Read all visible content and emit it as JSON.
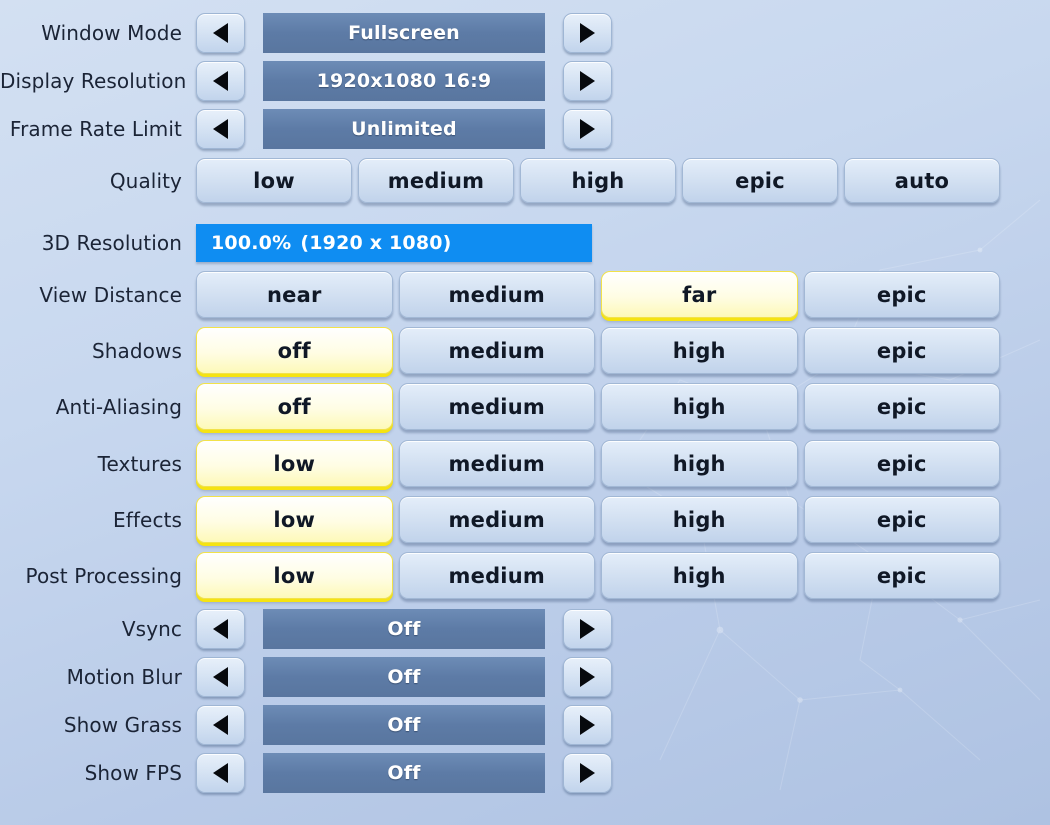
{
  "theme": {
    "accent_blue": "#0f8df2",
    "value_bar_blue": "#5d7ba6",
    "selected_yellow": "#f5e312",
    "label_color": "#1b2436"
  },
  "icons": {
    "left_arrow": "left-arrow-icon",
    "right_arrow": "right-arrow-icon"
  },
  "settings": {
    "window_mode": {
      "label": "Window Mode",
      "type": "stepper",
      "value": "Fullscreen"
    },
    "display_resolution": {
      "label": "Display Resolution",
      "type": "stepper",
      "value": "1920x1080 16:9"
    },
    "frame_rate_limit": {
      "label": "Frame Rate Limit",
      "type": "stepper",
      "value": "Unlimited"
    },
    "quality": {
      "label": "Quality",
      "type": "segmented",
      "options": [
        "low",
        "medium",
        "high",
        "epic",
        "auto"
      ],
      "selected_index": -1
    },
    "resolution_3d": {
      "label": "3D Resolution",
      "type": "slider",
      "percent": "100.0%",
      "detail": "(1920 x 1080)",
      "fill_percent": 100
    },
    "view_distance": {
      "label": "View Distance",
      "type": "segmented",
      "options": [
        "near",
        "medium",
        "far",
        "epic"
      ],
      "selected_index": 2
    },
    "shadows": {
      "label": "Shadows",
      "type": "segmented",
      "options": [
        "off",
        "medium",
        "high",
        "epic"
      ],
      "selected_index": 0
    },
    "anti_aliasing": {
      "label": "Anti-Aliasing",
      "type": "segmented",
      "options": [
        "off",
        "medium",
        "high",
        "epic"
      ],
      "selected_index": 0
    },
    "textures": {
      "label": "Textures",
      "type": "segmented",
      "options": [
        "low",
        "medium",
        "high",
        "epic"
      ],
      "selected_index": 0
    },
    "effects": {
      "label": "Effects",
      "type": "segmented",
      "options": [
        "low",
        "medium",
        "high",
        "epic"
      ],
      "selected_index": 0
    },
    "post_processing": {
      "label": "Post Processing",
      "type": "segmented",
      "options": [
        "low",
        "medium",
        "high",
        "epic"
      ],
      "selected_index": 0
    },
    "vsync": {
      "label": "Vsync",
      "type": "stepper",
      "value": "Off"
    },
    "motion_blur": {
      "label": "Motion Blur",
      "type": "stepper",
      "value": "Off"
    },
    "show_grass": {
      "label": "Show Grass",
      "type": "stepper",
      "value": "Off"
    },
    "show_fps": {
      "label": "Show FPS",
      "type": "stepper",
      "value": "Off"
    }
  }
}
